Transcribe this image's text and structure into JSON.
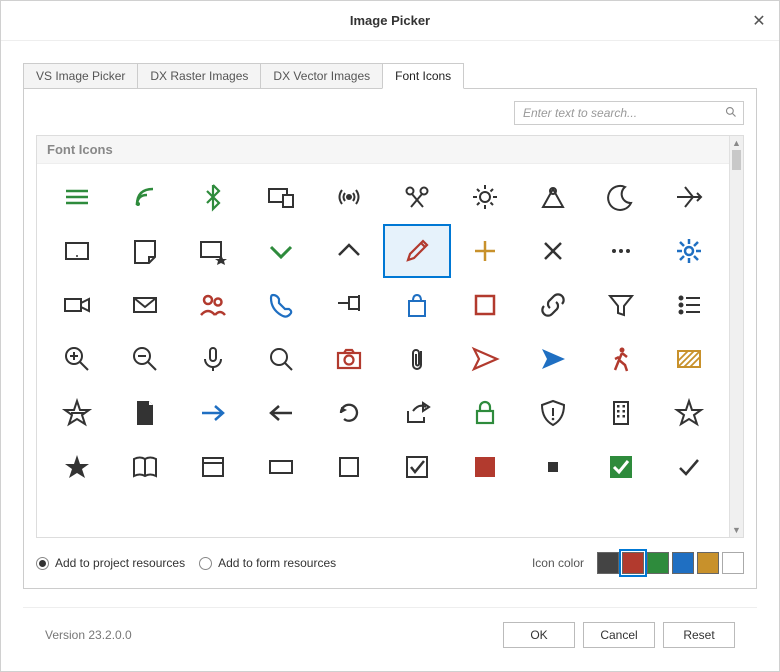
{
  "window": {
    "title": "Image Picker"
  },
  "tabs": [
    {
      "label": "VS Image Picker"
    },
    {
      "label": "DX Raster Images"
    },
    {
      "label": "DX Vector Images"
    },
    {
      "label": "Font Icons"
    }
  ],
  "search": {
    "placeholder": "Enter text to search..."
  },
  "group_header": "Font Icons",
  "options": {
    "radio1": "Add to project resources",
    "radio2": "Add to form resources",
    "color_label": "Icon color"
  },
  "swatches": [
    "#444444",
    "#b23a2e",
    "#2e8b3c",
    "#1f6fc2",
    "#c8912b",
    "#ffffff"
  ],
  "footer": {
    "version": "Version 23.2.0.0",
    "ok": "OK",
    "cancel": "Cancel",
    "reset": "Reset"
  }
}
